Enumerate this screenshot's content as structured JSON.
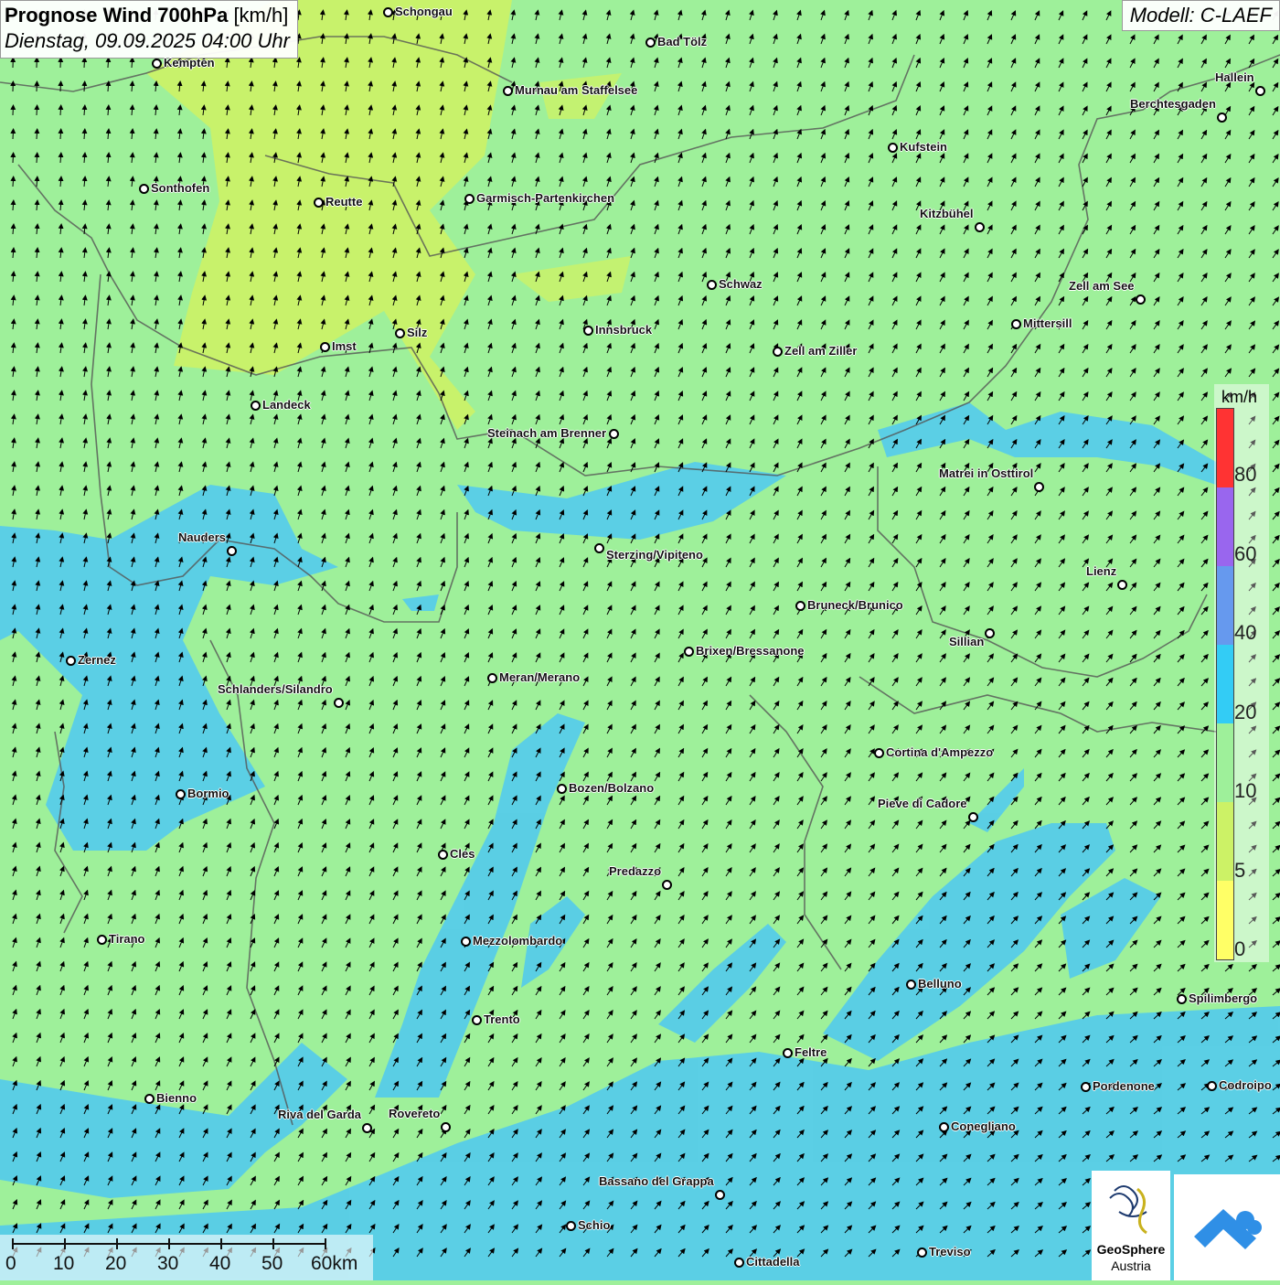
{
  "title": {
    "main": "Prognose Wind 700hPa",
    "unit": "[km/h]",
    "datetime": "Dienstag, 09.09.2025 04:00 Uhr"
  },
  "model": "Modell: C-LAEF",
  "legend": {
    "unit": "km/h",
    "labels": [
      "80",
      "60",
      "40",
      "20",
      "10",
      "5",
      "0"
    ],
    "colors": [
      "#ff3333",
      "#9966ee",
      "#6699ee",
      "#33ccf5",
      "#9ef09a",
      "#ccf266",
      "#ffff66"
    ]
  },
  "scale": {
    "ticks": [
      "0",
      "10",
      "20",
      "30",
      "40",
      "50",
      "60km"
    ]
  },
  "logo": {
    "brand_line1": "GeoSphere",
    "brand_line2": "Austria"
  },
  "cities": [
    {
      "name": "Schongau"
    },
    {
      "name": "Bad Tölz"
    },
    {
      "name": "Kempten"
    },
    {
      "name": "Murnau am Staffelsee"
    },
    {
      "name": "Hallein"
    },
    {
      "name": "Berchtesgaden"
    },
    {
      "name": "Kufstein"
    },
    {
      "name": "Sonthofen"
    },
    {
      "name": "Reutte"
    },
    {
      "name": "Garmisch-Partenkirchen"
    },
    {
      "name": "Kitzbühel"
    },
    {
      "name": "Schwaz"
    },
    {
      "name": "Zell am See"
    },
    {
      "name": "Mittersill"
    },
    {
      "name": "Innsbruck"
    },
    {
      "name": "Imst"
    },
    {
      "name": "Silz"
    },
    {
      "name": "Zell am Ziller"
    },
    {
      "name": "Landeck"
    },
    {
      "name": "Steinach am Brenner"
    },
    {
      "name": "Matrei in Osttirol"
    },
    {
      "name": "Nauders"
    },
    {
      "name": "Sterzing/Vipiteno"
    },
    {
      "name": "Lienz"
    },
    {
      "name": "Bruneck/Brunico"
    },
    {
      "name": "Sillian"
    },
    {
      "name": "Zernez"
    },
    {
      "name": "Brixen/Bressanone"
    },
    {
      "name": "Meran/Merano"
    },
    {
      "name": "Schlanders/Silandro"
    },
    {
      "name": "Cortina d'Ampezzo"
    },
    {
      "name": "Bormio"
    },
    {
      "name": "Bozen/Bolzano"
    },
    {
      "name": "Pieve di Cadore"
    },
    {
      "name": "Cles"
    },
    {
      "name": "Predazzo"
    },
    {
      "name": "Tirano"
    },
    {
      "name": "Mezzolombardo"
    },
    {
      "name": "Belluno"
    },
    {
      "name": "Spilimbergo"
    },
    {
      "name": "Trento"
    },
    {
      "name": "Feltre"
    },
    {
      "name": "Bienno"
    },
    {
      "name": "Pordenone"
    },
    {
      "name": "Codroipo"
    },
    {
      "name": "Riva del Garda"
    },
    {
      "name": "Rovereto"
    },
    {
      "name": "Conegliano"
    },
    {
      "name": "Bassano del Grappa"
    },
    {
      "name": "Schio"
    },
    {
      "name": "Treviso"
    },
    {
      "name": "Cittadella"
    }
  ]
}
